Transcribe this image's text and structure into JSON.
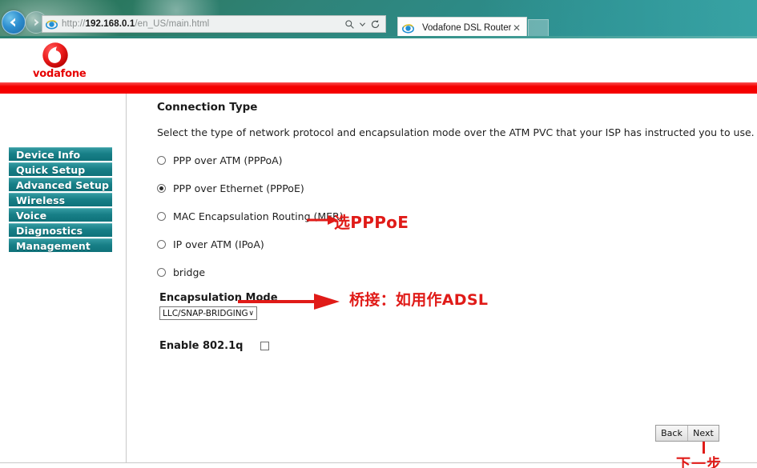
{
  "browser": {
    "back_title": "Back",
    "forward_title": "Forward",
    "url_prefix": "http://",
    "url_host": "192.168.0.1",
    "url_path": "/en_US/main.html",
    "search_icon": "search-icon",
    "dropdown_icon": "chevron-down-icon",
    "refresh_icon": "refresh-icon",
    "tab": {
      "title": "Vodafone DSL Router",
      "close_label": "✕",
      "favicon": "ie-icon"
    },
    "new_tab_label": ""
  },
  "brand": {
    "name": "vodafone",
    "logo_icon": "vodafone-logo-icon",
    "accent_red": "#f50000"
  },
  "sidebar": {
    "items": [
      {
        "label": "Device Info"
      },
      {
        "label": "Quick Setup"
      },
      {
        "label": "Advanced Setup"
      },
      {
        "label": "Wireless"
      },
      {
        "label": "Voice"
      },
      {
        "label": "Diagnostics"
      },
      {
        "label": "Management"
      }
    ],
    "accent_teal": "#157f87"
  },
  "main": {
    "title": "Connection Type",
    "description": "Select the type of network protocol and encapsulation mode over the ATM PVC that your ISP has instructed you to use. Note that",
    "connection_types": [
      {
        "label": "PPP over ATM (PPPoA)",
        "selected": false
      },
      {
        "label": "PPP over Ethernet (PPPoE)",
        "selected": true
      },
      {
        "label": "MAC Encapsulation Routing (MER)",
        "selected": false
      },
      {
        "label": "IP over ATM (IPoA)",
        "selected": false
      },
      {
        "label": "bridge",
        "selected": false
      }
    ],
    "encapsulation": {
      "label": "Encapsulation Mode",
      "value": "LLC/SNAP-BRIDGING",
      "caret": "∨"
    },
    "vlan": {
      "label": "Enable 802.1q",
      "checked": false
    },
    "buttons": {
      "back": "Back",
      "next": "Next"
    }
  },
  "annotations": {
    "color": "#e01b18",
    "pppoe": "选PPPoE",
    "bridge": "桥接：如用作ADSL",
    "next_step": "下一步"
  }
}
